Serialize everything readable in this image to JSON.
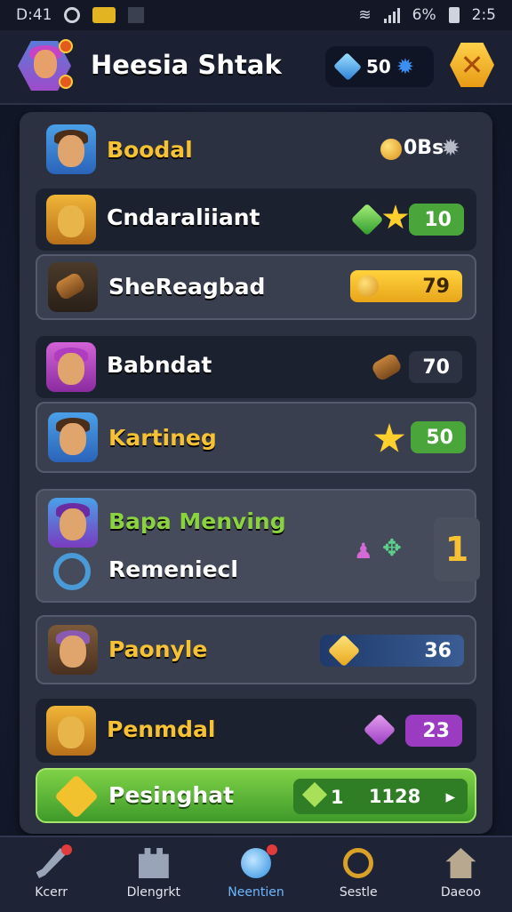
{
  "status_bar": {
    "time": "D:41",
    "battery": "6%",
    "clock_right": "2:5"
  },
  "header": {
    "title": "Heesia Shtak",
    "currency_value": "50",
    "icons": {
      "currency": "gem-icon",
      "settings": "gear-icon",
      "close": "close-icon"
    }
  },
  "rows": [
    {
      "name": "Boodal",
      "value": "0Bs",
      "name_color": "#f6c132",
      "icon": "coin-icon"
    },
    {
      "name": "Cndaraliiant",
      "value": "10",
      "name_color": "#ffffff",
      "icon": "star-icon"
    },
    {
      "name": "SheReagbad",
      "value": "79",
      "name_color": "#ffffff",
      "icon": "coin-icon"
    },
    {
      "name": "Babndat",
      "value": "70",
      "name_color": "#ffffff",
      "icon": "log-icon"
    },
    {
      "name": "Kartineg",
      "value": "50",
      "name_color": "#f6c132",
      "icon": "star-icon"
    },
    {
      "name": "Bapa Menving",
      "subname": "Remeniecl",
      "value": "1",
      "name_color": "#8ad33f",
      "icon": "trophy-icon"
    },
    {
      "name": "Paonyle",
      "value": "36",
      "name_color": "#f6c132",
      "icon": "gem-icon"
    },
    {
      "name": "Penmdal",
      "value": "23",
      "name_color": "#f6c132",
      "icon": "gem-icon"
    }
  ],
  "cta": {
    "label": "Pesinghat",
    "count": "1",
    "value": "1128"
  },
  "nav": [
    {
      "label": "Kcerr",
      "icon": "sword-icon"
    },
    {
      "label": "Dlengrkt",
      "icon": "castle-icon"
    },
    {
      "label": "Neentien",
      "icon": "bird-icon"
    },
    {
      "label": "Sestle",
      "icon": "ring-icon"
    },
    {
      "label": "Daeoo",
      "icon": "home-icon"
    }
  ]
}
